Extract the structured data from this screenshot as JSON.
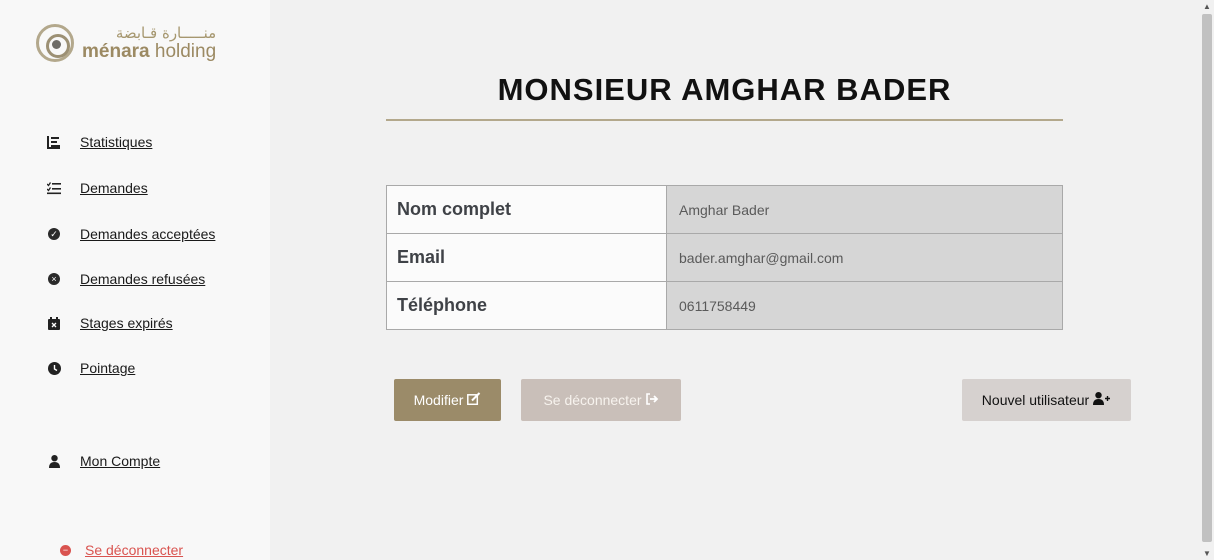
{
  "brand": {
    "arabic": "منـــــارة قـابضة",
    "name_bold": "ménara",
    "name_rest": " holding"
  },
  "nav": {
    "items": [
      {
        "label": "Statistiques",
        "icon": "list-icon"
      },
      {
        "label": "Demandes",
        "icon": "tasks-icon"
      },
      {
        "label": "Demandes acceptées",
        "icon": "check-circle-icon"
      },
      {
        "label": "Demandes refusées",
        "icon": "times-circle-icon"
      },
      {
        "label": "Stages expirés",
        "icon": "calendar-x-icon"
      },
      {
        "label": "Pointage",
        "icon": "clock-icon"
      },
      {
        "label": "Mon Compte",
        "icon": "user-icon"
      }
    ],
    "logout_label": "Se déconnecter"
  },
  "profile": {
    "title": "MONSIEUR AMGHAR BADER",
    "rows": [
      {
        "key": "Nom complet",
        "value": "Amghar Bader"
      },
      {
        "key": "Email",
        "value": "bader.amghar@gmail.com"
      },
      {
        "key": "Téléphone",
        "value": "0611758449"
      }
    ]
  },
  "actions": {
    "modifier": "Modifier",
    "deconnecter": "Se déconnecter",
    "nouvel_utilisateur": "Nouvel utilisateur"
  },
  "colors": {
    "accent": "#9b8b69",
    "danger": "#d9534f"
  }
}
